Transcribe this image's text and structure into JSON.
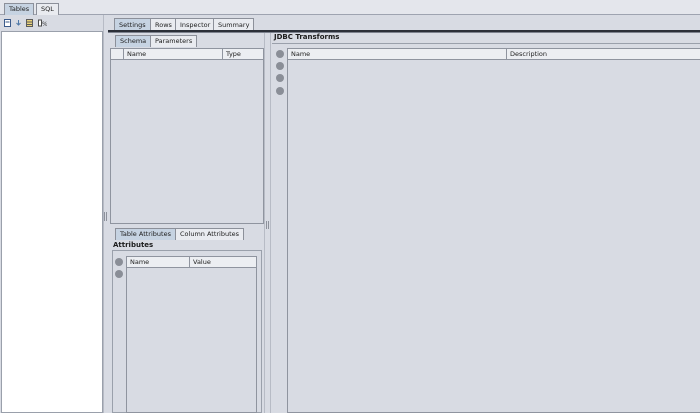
{
  "top_tabs": [
    {
      "label": "Tables",
      "active": true
    },
    {
      "label": "SQL",
      "active": false
    }
  ],
  "left_toolbar": {
    "icons": [
      "new-table-icon",
      "refresh-icon",
      "grid-view-icon",
      "percent-icon"
    ]
  },
  "main_tabs": [
    {
      "label": "Settings",
      "active": true
    },
    {
      "label": "Rows",
      "active": false
    },
    {
      "label": "Inspector",
      "active": false
    },
    {
      "label": "Summary",
      "active": false
    }
  ],
  "schema_panel": {
    "tabs": [
      {
        "label": "Schema",
        "active": true
      },
      {
        "label": "Parameters",
        "active": false
      }
    ],
    "columns": [
      "Name",
      "Type"
    ]
  },
  "attributes_panel": {
    "tabs": [
      {
        "label": "Table Attributes",
        "active": true
      },
      {
        "label": "Column Attributes",
        "active": false
      }
    ],
    "title": "Attributes",
    "columns": [
      "Name",
      "Value"
    ]
  },
  "jdbc_panel": {
    "title": "JDBC Transforms",
    "columns": [
      "Name",
      "Description"
    ]
  },
  "colors": {
    "background": "#d8dbe3",
    "active_tab": "#c6d3e2",
    "tree_background": "#ffffff"
  }
}
